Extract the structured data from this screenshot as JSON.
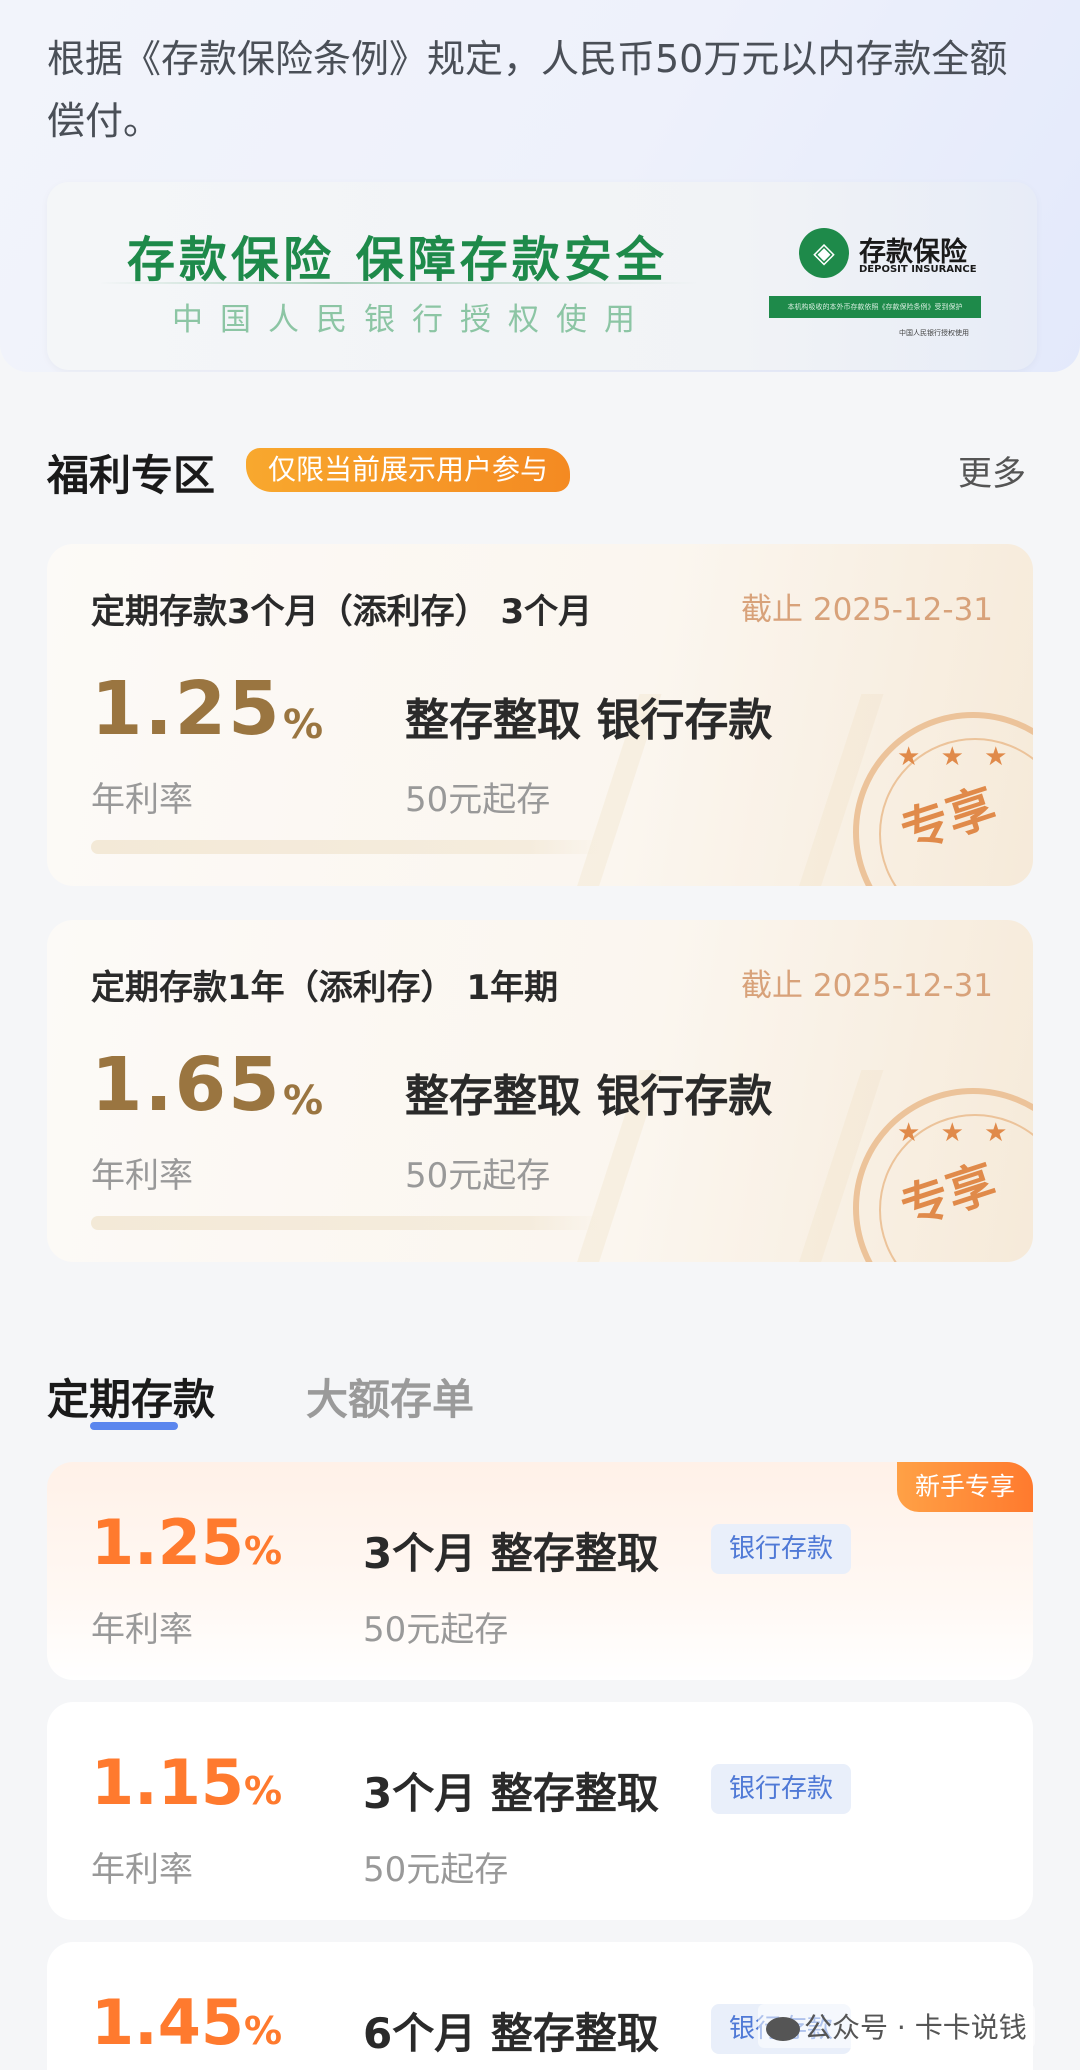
{
  "insurance": {
    "notice": "根据《存款保险条例》规定，人民币50万元以内存款全额偿付。",
    "banner_title": "存款保险 保障存款安全",
    "banner_subtitle": "中国人民银行授权使用",
    "logo_cn": "存款保险",
    "logo_en": "DEPOSIT INSURANCE",
    "logo_bar_text": "本机构吸收的本外币存款依照《存款保险条例》受到保护",
    "logo_foot": "中国人民银行授权使用",
    "colors": {
      "green": "#1e8a4a"
    }
  },
  "welfare": {
    "title": "福利专区",
    "badge": "仅限当前展示用户参与",
    "more": "更多",
    "cards": [
      {
        "title": "定期存款3个月（添利存） 3个月",
        "deadline": "截止 2025-12-31",
        "rate": "1.25",
        "pct": "%",
        "rate_label": "年利率",
        "kind": "整存整取  银行存款",
        "min": "50元起存",
        "stamp": "专享",
        "stars": "★ ★ ★"
      },
      {
        "title": "定期存款1年（添利存） 1年期",
        "deadline": "截止 2025-12-31",
        "rate": "1.65",
        "pct": "%",
        "rate_label": "年利率",
        "kind": "整存整取  银行存款",
        "min": "50元起存",
        "stamp": "专享",
        "stars": "★ ★ ★"
      }
    ]
  },
  "tabs": {
    "active": "定期存款",
    "inactive": "大额存单"
  },
  "products": [
    {
      "rate": "1.25",
      "pct": "%",
      "rate_label": "年利率",
      "term": "3个月  整存整取",
      "tag": "银行存款",
      "min": "50元起存",
      "badge": "新手专享"
    },
    {
      "rate": "1.15",
      "pct": "%",
      "rate_label": "年利率",
      "term": "3个月  整存整取",
      "tag": "银行存款",
      "min": "50元起存"
    },
    {
      "rate": "1.45",
      "pct": "%",
      "term": "6个月  整存整取",
      "tag": "银行存款"
    }
  ],
  "watermark": "公众号 · 卡卡说钱",
  "icons": [
    "deposit-insurance-logo-icon",
    "star-icon",
    "wechat-icon"
  ]
}
